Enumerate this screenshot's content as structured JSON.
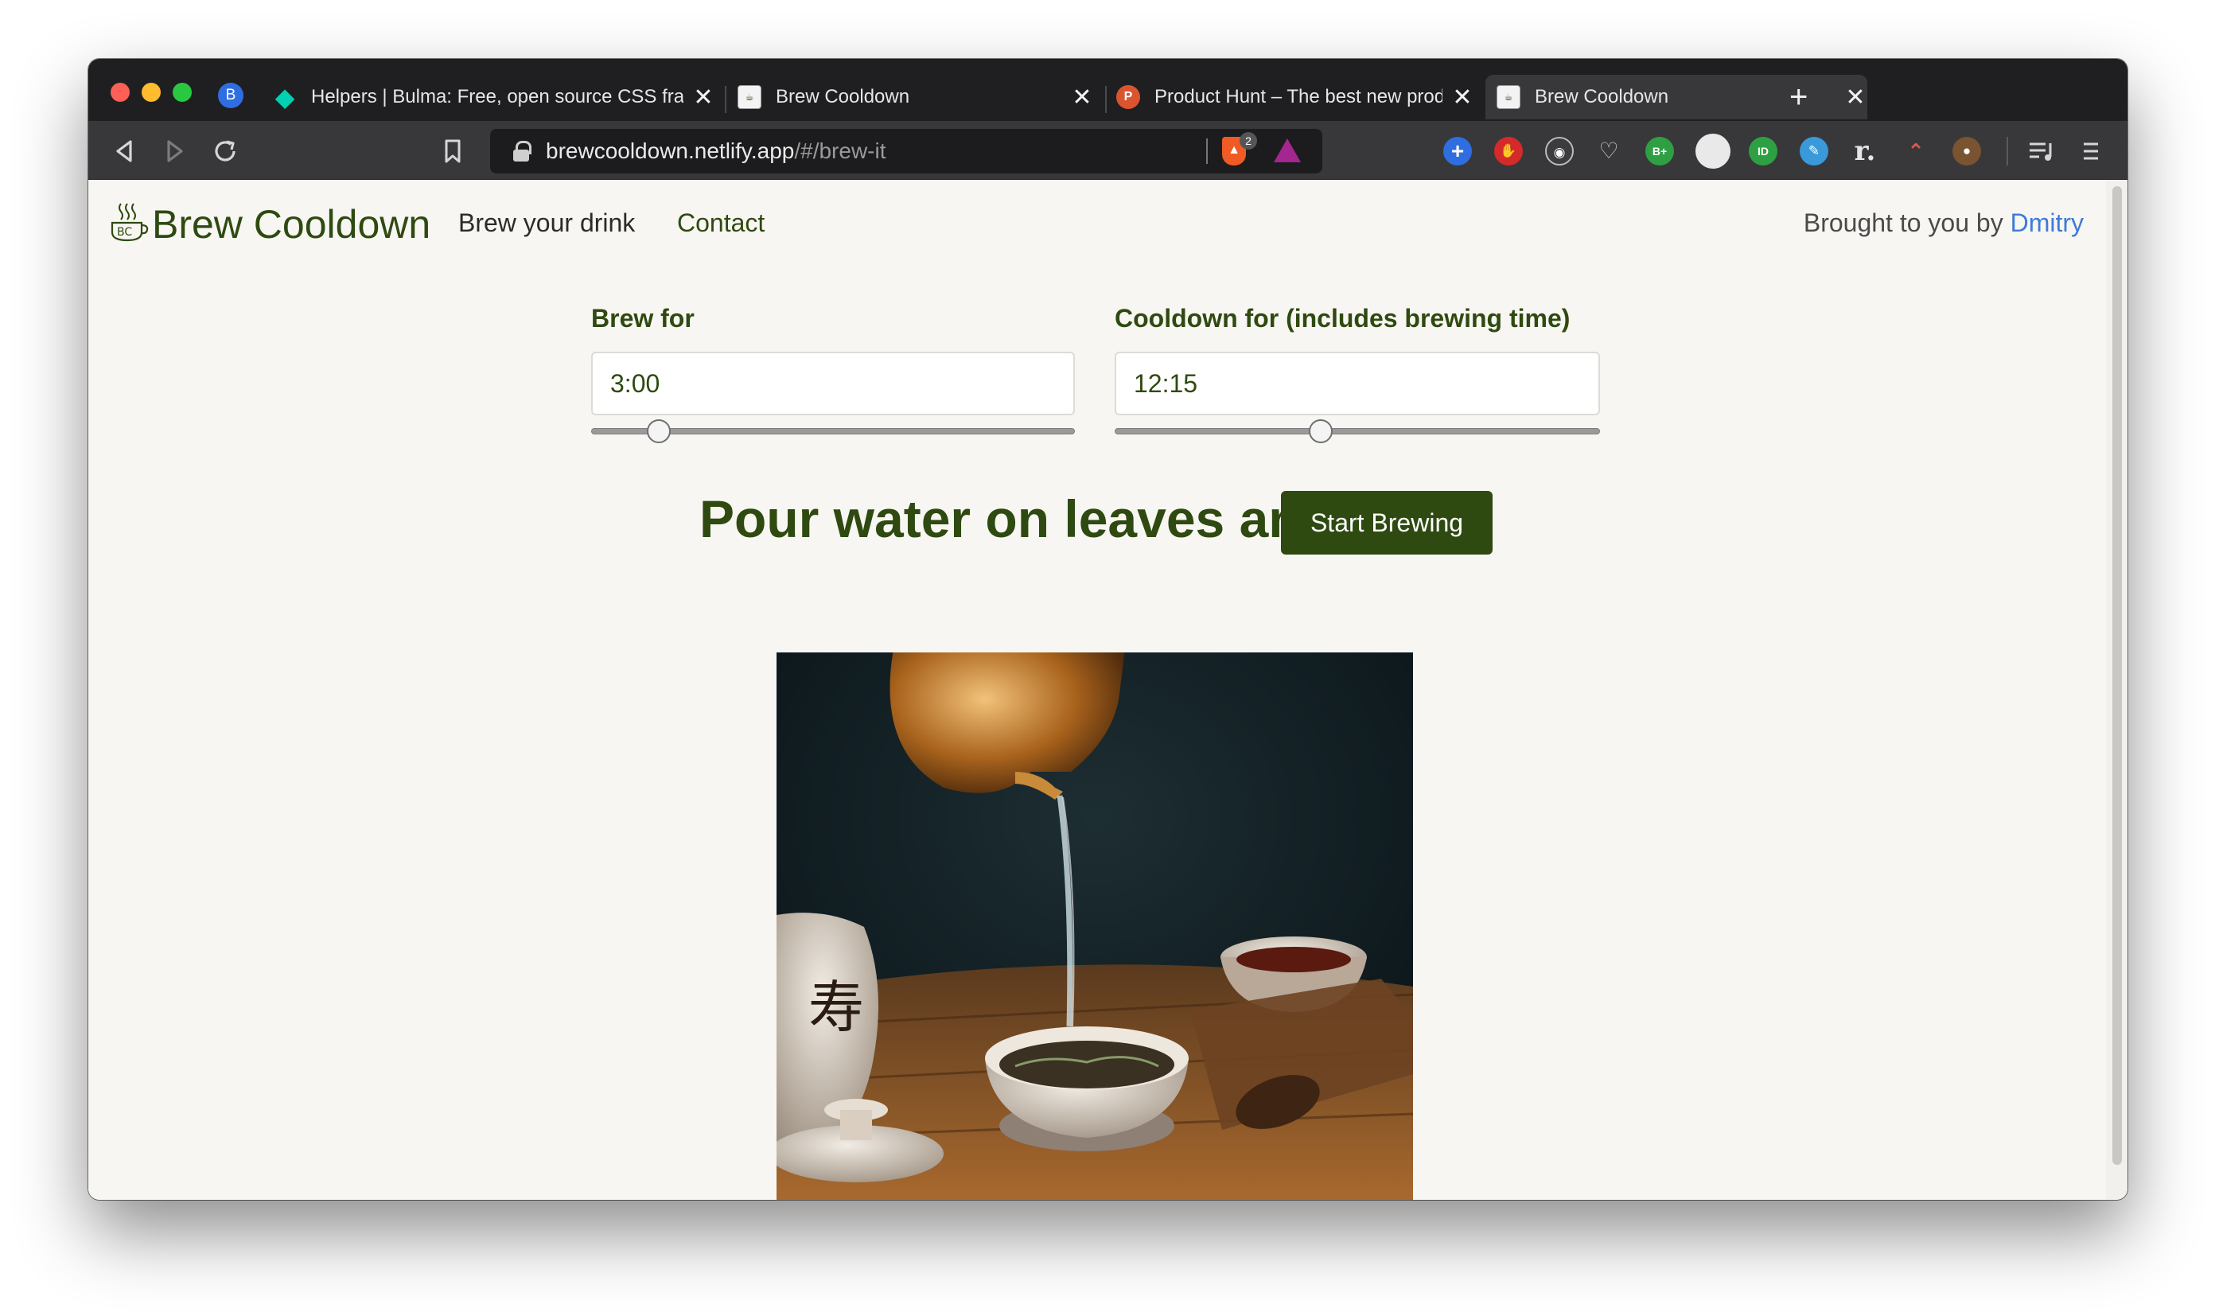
{
  "browser": {
    "profile_initial": "B",
    "tabs": [
      {
        "title": "Helpers | Bulma: Free, open source CSS framework",
        "favicon": "bulma-icon"
      },
      {
        "title": "Brew Cooldown",
        "favicon": "brew-cooldown-icon"
      },
      {
        "title": "Product Hunt – The best new products in tech",
        "favicon": "product-hunt-icon",
        "favicon_letter": "P"
      },
      {
        "title": "Brew Cooldown",
        "favicon": "brew-cooldown-icon",
        "active": true
      }
    ],
    "tab_close": "✕",
    "new_tab": "+",
    "url_host": "brewcooldown.netlify.app",
    "url_path": "/#/brew-it",
    "shield_count": "2",
    "extension_badge": "B+",
    "extension_badge_2": "ID"
  },
  "nav": {
    "logo_text": "BC",
    "brand": "Brew Cooldown",
    "links": [
      "Brew your drink",
      "Contact"
    ],
    "credit_prefix": "Brought to you by",
    "credit_name": "Dmitry"
  },
  "brew": {
    "label": "Brew for",
    "value": "3:00",
    "slider_fraction": 0.12
  },
  "cooldown": {
    "label": "Cooldown for (includes brewing time)",
    "value": "12:15",
    "slider_fraction": 0.42
  },
  "main": {
    "headline": "Pour water on leaves and",
    "start_button": "Start Brewing"
  },
  "colors": {
    "brand_green": "#2f4a11",
    "link_blue": "#3e7bd8",
    "page_bg": "#f8f6f2"
  }
}
